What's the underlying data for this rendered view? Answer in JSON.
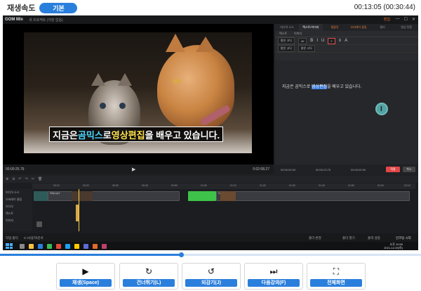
{
  "topbar": {
    "speed_label": "재생속도",
    "speed_value": "기본",
    "time": "00:13:05 (00:30:44)"
  },
  "app": {
    "logo": "GOM Mix",
    "project": "새 프로젝트 (저장 없음)",
    "edit_label": "편집"
  },
  "preview": {
    "subtitle_pre": "지금은 ",
    "subtitle_hl1": "곰믹스",
    "subtitle_mid": "로 ",
    "subtitle_hl2": "영상편집",
    "subtitle_post": "을 배우고 있습니다.",
    "timecode": "00:00:25.79",
    "duration": "0:02:08.27",
    "play_icon": "play-icon"
  },
  "sidepanel": {
    "tabs": [
      "미디어 소스",
      "텍스트/이미지",
      "템플릿",
      "오버레이 클립",
      "필터",
      "영상 전환"
    ],
    "subtabs": [
      "텍스트",
      "이미지"
    ],
    "font": "맑은 고딕",
    "size": "40",
    "text_pre": "지금은 곰믹스로 ",
    "text_selected": "영상편집",
    "text_post": "을 배우고 있습니다.",
    "foot_start": "00:00:00.00",
    "foot_end": "00:00:23.79",
    "foot_dur": "00:00:00.00",
    "apply": "적용",
    "cancel": "취소"
  },
  "timeline": {
    "ruler_ticks": [
      "00:10",
      "00:20",
      "00:30",
      "00:40",
      "00:50",
      "01:00",
      "01:10",
      "01:20",
      "01:30",
      "01:40",
      "01:50",
      "02:00",
      "02:10"
    ],
    "track_labels": [
      "미디어 소스",
      "오버레이 클립",
      "오디오",
      "텍스트",
      "이미지"
    ],
    "clips": [
      "Kitty.mp4",
      "Cat.mp4"
    ]
  },
  "bottom_strip": {
    "left1": "작업 폴더",
    "left2": "C:\\사용자\\문서",
    "right1": "폴더 변경",
    "right2": "폴더 열기",
    "right3": "출력 설정",
    "right4": "인코딩 시작"
  },
  "taskbar": {
    "time": "오후 10:59",
    "date": "2021-12-09(목)"
  },
  "progress": {
    "fraction": 0.43
  },
  "controls": [
    {
      "icon": "play-icon",
      "symbol": "▶",
      "label": "재생(Space)"
    },
    {
      "icon": "skip-forward-icon",
      "symbol": "↻",
      "label": "건너뛰기(L)"
    },
    {
      "icon": "rewind-icon",
      "symbol": "↺",
      "label": "되감기(J)"
    },
    {
      "icon": "next-lecture-icon",
      "symbol": "⏭",
      "label": "다음강의(F)"
    },
    {
      "icon": "fullscreen-icon",
      "symbol": "⛶",
      "label": "전체화면"
    }
  ]
}
